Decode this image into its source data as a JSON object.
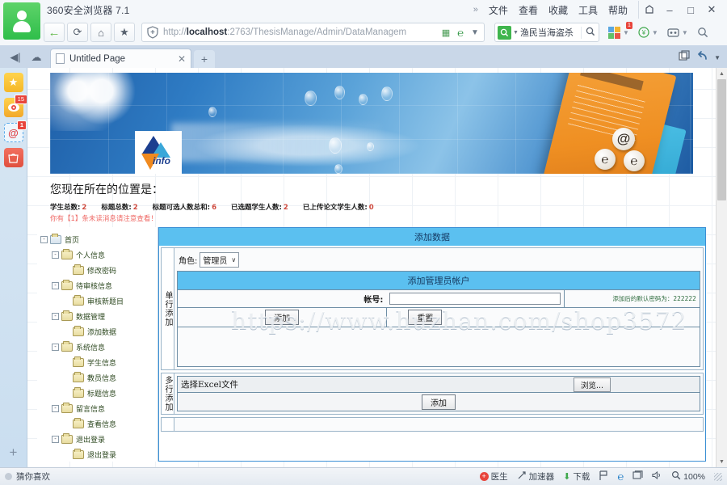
{
  "browser": {
    "title": "360安全浏览器 7.1",
    "menu": [
      "文件",
      "查看",
      "收藏",
      "工具",
      "帮助"
    ],
    "menu_overflow": "»",
    "window_buttons": {
      "skin": "skin-icon",
      "minimize": "–",
      "maximize": "□",
      "close": "✕"
    },
    "nav": {
      "back": "←",
      "refresh": "⟳",
      "home": "⌂",
      "favorite": "★"
    },
    "address": {
      "scheme": "http://",
      "host": "localhost",
      "rest": ":2763/ThesisManage/Admin/DataManagem",
      "full": "http://localhost:2763/ThesisManage/Admin/DataManagem",
      "shield_icon": "shield-icon",
      "qr_icon": "qr-icon",
      "ie_icon": "ie-icon",
      "dropdown_icon": "chevron-down-icon"
    },
    "search": {
      "value": "渔民当海盗杀",
      "engine_icon": "360-search-icon",
      "submit_icon": "magnifier-icon"
    },
    "toolbar_icons": [
      {
        "name": "apps-grid-icon",
        "badge": "1"
      },
      {
        "name": "wallet-icon",
        "badge": ""
      },
      {
        "name": "screenshot-icon",
        "badge": ""
      },
      {
        "name": "magnifier-tool-icon",
        "badge": ""
      }
    ],
    "tabbar": {
      "list_icon": "tab-list-icon",
      "cloud_icon": "cloud-icon",
      "tab_title": "Untitled Page",
      "tab_close": "✕",
      "new_tab": "+",
      "right_icons": [
        "window-restore-icon",
        "undo-icon",
        "chevron-down-icon"
      ]
    },
    "sidebar_icons": [
      {
        "name": "favorites-star-icon",
        "glyph": "★",
        "badge": ""
      },
      {
        "name": "weibo-icon",
        "glyph": "◉",
        "badge": "15"
      },
      {
        "name": "mail-at-icon",
        "glyph": "@",
        "badge": "1"
      },
      {
        "name": "shopping-bag-icon",
        "glyph": "℆",
        "badge": ""
      },
      {
        "name": "add-panel-icon",
        "glyph": "+",
        "badge": ""
      }
    ],
    "statusbar": {
      "left_label": "猜你喜欢",
      "items": [
        {
          "name": "doctor",
          "label": "医生",
          "icon": "red-plus-icon"
        },
        {
          "name": "accelerator",
          "label": "加速器",
          "icon": "rocket-icon"
        },
        {
          "name": "download",
          "label": "下载",
          "icon": "download-arrow-icon"
        },
        {
          "name": "flag",
          "label": "",
          "icon": "flag-icon"
        },
        {
          "name": "ie-core",
          "label": "",
          "icon": "ie-icon"
        },
        {
          "name": "window-mode",
          "label": "",
          "icon": "window-icon"
        },
        {
          "name": "sound",
          "label": "",
          "icon": "speaker-icon"
        }
      ],
      "zoom": "100%",
      "zoom_icon": "zoom-icon"
    }
  },
  "page": {
    "banner": {
      "logo_text": "info",
      "at_symbols": [
        "@",
        "℮",
        "℮"
      ]
    },
    "location_label": "您现在所在的位置是：",
    "stats": [
      {
        "label": "学生总数:",
        "value": "2"
      },
      {
        "label": "标题总数:",
        "value": "2"
      },
      {
        "label": "标题可选人数总和:",
        "value": "6"
      },
      {
        "label": "已选题学生人数:",
        "value": "2"
      },
      {
        "label": "已上传论文学生人数:",
        "value": "0"
      }
    ],
    "warning": "你有【1】条未读消息请注意查看！",
    "watermark": "https://www.huzhan.com/shop3572",
    "tree": [
      {
        "label": "首页",
        "level": 0,
        "expander": "-",
        "icon": "home-folder-icon"
      },
      {
        "label": "个人信息",
        "level": 1,
        "expander": "-",
        "icon": "folder-icon"
      },
      {
        "label": "修改密码",
        "level": 2,
        "expander": "",
        "icon": "folder-icon"
      },
      {
        "label": "待审核信息",
        "level": 1,
        "expander": "-",
        "icon": "folder-icon"
      },
      {
        "label": "审核新题目",
        "level": 2,
        "expander": "",
        "icon": "folder-icon"
      },
      {
        "label": "数据管理",
        "level": 1,
        "expander": "-",
        "icon": "folder-icon"
      },
      {
        "label": "添加数据",
        "level": 2,
        "expander": "",
        "icon": "folder-icon"
      },
      {
        "label": "系统信息",
        "level": 1,
        "expander": "-",
        "icon": "folder-icon"
      },
      {
        "label": "学生信息",
        "level": 2,
        "expander": "",
        "icon": "folder-icon"
      },
      {
        "label": "教员信息",
        "level": 2,
        "expander": "",
        "icon": "folder-icon"
      },
      {
        "label": "标题信息",
        "level": 2,
        "expander": "",
        "icon": "folder-icon"
      },
      {
        "label": "留言信息",
        "level": 1,
        "expander": "-",
        "icon": "folder-icon"
      },
      {
        "label": "查看信息",
        "level": 2,
        "expander": "",
        "icon": "folder-icon"
      },
      {
        "label": "退出登录",
        "level": 1,
        "expander": "-",
        "icon": "folder-icon"
      },
      {
        "label": "退出登录",
        "level": 2,
        "expander": "",
        "icon": "folder-icon"
      }
    ],
    "panel_title": "添加数据",
    "single_add": {
      "vertical_label": "单行添加",
      "role_label": "角色:",
      "role_value": "管理员",
      "role_caret": "∨",
      "form_title": "添加管理员帐户",
      "account_label": "帐号:",
      "account_value": "",
      "password_hint": "添加后的默认密码为：222222",
      "add_button": "添加",
      "reset_button": "重置"
    },
    "multi_add": {
      "vertical_label": "多行添加",
      "file_label": "选择Excel文件",
      "browse_button": "浏览...",
      "add_button": "添加"
    }
  }
}
